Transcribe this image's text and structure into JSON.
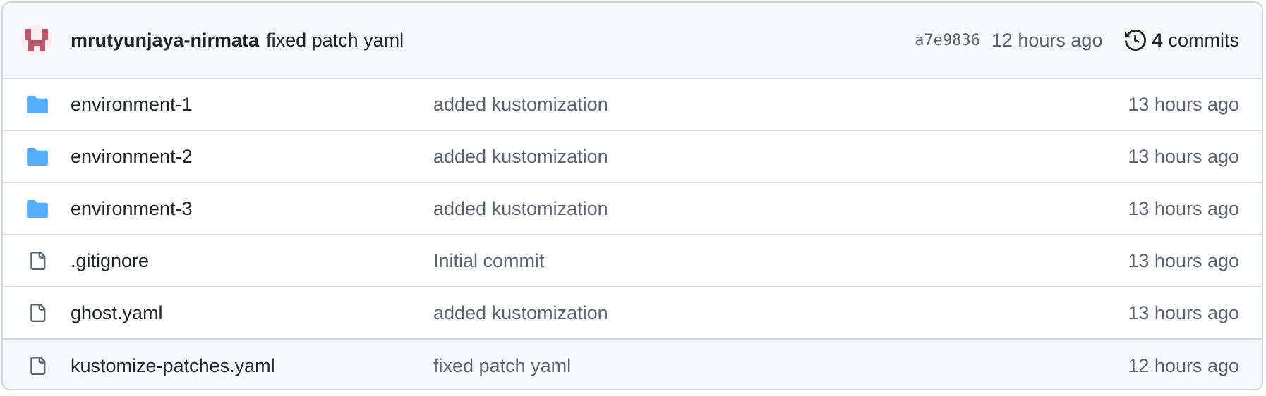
{
  "latest_commit": {
    "author": "mrutyunjaya-nirmata",
    "message": "fixed patch yaml",
    "sha": "a7e9836",
    "time_ago": "12 hours ago",
    "commit_count": "4",
    "commits_label": "commits",
    "history_icon": "history-icon",
    "avatar_color": "#c0546a"
  },
  "files": [
    {
      "type": "folder",
      "icon": "folder-icon",
      "name": "environment-1",
      "message": "added kustomization",
      "time": "13 hours ago"
    },
    {
      "type": "folder",
      "icon": "folder-icon",
      "name": "environment-2",
      "message": "added kustomization",
      "time": "13 hours ago"
    },
    {
      "type": "folder",
      "icon": "folder-icon",
      "name": "environment-3",
      "message": "added kustomization",
      "time": "13 hours ago"
    },
    {
      "type": "file",
      "icon": "file-icon",
      "name": ".gitignore",
      "message": "Initial commit",
      "time": "13 hours ago"
    },
    {
      "type": "file",
      "icon": "file-icon",
      "name": "ghost.yaml",
      "message": "added kustomization",
      "time": "13 hours ago"
    },
    {
      "type": "file",
      "icon": "file-icon",
      "name": "kustomize-patches.yaml",
      "message": "fixed patch yaml",
      "time": "12 hours ago"
    }
  ],
  "colors": {
    "folder": "#54aeff",
    "file": "#59636e",
    "border": "#d0d7de",
    "header_bg": "#f6f8fa"
  }
}
